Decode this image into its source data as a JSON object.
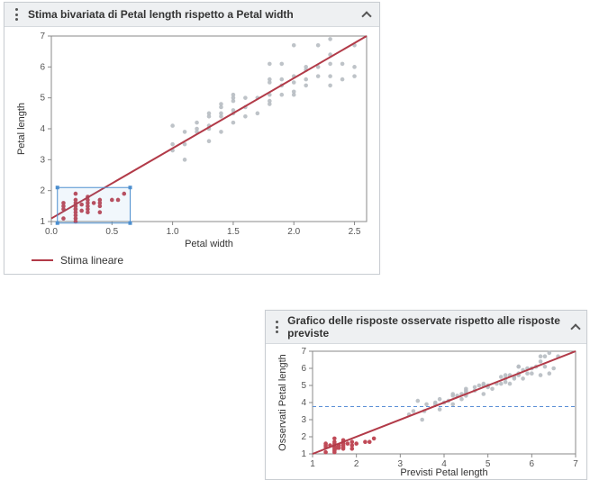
{
  "panel_top": {
    "title": "Stima bivariata di Petal length rispetto a Petal width",
    "legend_label": "Stima lineare"
  },
  "panel_bottom": {
    "title": "Grafico delle risposte osservate rispetto alle risposte previste"
  },
  "colors": {
    "fit": "#b23a48",
    "point_gray": "#b7bcc2",
    "point_red": "#c04a57",
    "dashed": "#5a8fd6"
  },
  "chart_data": [
    {
      "id": "bivariate",
      "type": "scatter",
      "title": "Stima bivariata di Petal length rispetto a Petal width",
      "xlabel": "Petal width",
      "ylabel": "Petal length",
      "xlim": [
        0.0,
        2.6
      ],
      "ylim": [
        1,
        7
      ],
      "xticks": [
        0.0,
        0.5,
        1.0,
        1.5,
        2.0,
        2.5
      ],
      "yticks": [
        1,
        2,
        3,
        4,
        5,
        6,
        7
      ],
      "fit_line": {
        "x1": 0.0,
        "y1": 1.1,
        "x2": 2.6,
        "y2": 7.0
      },
      "selection_rect": {
        "x1": 0.05,
        "y1": 0.95,
        "x2": 0.65,
        "y2": 2.1
      },
      "legend": "Stima lineare",
      "series": [
        {
          "name": "selected",
          "color": "red",
          "points": [
            [
              0.1,
              1.4
            ],
            [
              0.2,
              1.4
            ],
            [
              0.2,
              1.3
            ],
            [
              0.2,
              1.5
            ],
            [
              0.2,
              1.2
            ],
            [
              0.2,
              1.6
            ],
            [
              0.2,
              1.0
            ],
            [
              0.1,
              1.5
            ],
            [
              0.2,
              1.7
            ],
            [
              0.1,
              1.1
            ],
            [
              0.3,
              1.4
            ],
            [
              0.3,
              1.6
            ],
            [
              0.3,
              1.3
            ],
            [
              0.4,
              1.5
            ],
            [
              0.4,
              1.7
            ],
            [
              0.2,
              1.9
            ],
            [
              0.4,
              1.3
            ],
            [
              0.1,
              1.6
            ],
            [
              0.3,
              1.5
            ],
            [
              0.2,
              1.4
            ],
            [
              0.25,
              1.55
            ],
            [
              0.3,
              1.7
            ],
            [
              0.2,
              1.1
            ],
            [
              0.35,
              1.6
            ],
            [
              0.3,
              1.8
            ],
            [
              0.25,
              1.35
            ],
            [
              0.4,
              1.6
            ],
            [
              0.5,
              1.7
            ],
            [
              0.55,
              1.7
            ],
            [
              0.6,
              1.9
            ]
          ]
        },
        {
          "name": "unselected",
          "color": "gray",
          "points": [
            [
              1.0,
              3.3
            ],
            [
              1.0,
              3.5
            ],
            [
              1.1,
              3.0
            ],
            [
              1.1,
              3.9
            ],
            [
              1.2,
              3.9
            ],
            [
              1.2,
              4.0
            ],
            [
              1.3,
              4.0
            ],
            [
              1.3,
              4.1
            ],
            [
              1.3,
              4.4
            ],
            [
              1.3,
              3.6
            ],
            [
              1.3,
              4.5
            ],
            [
              1.4,
              4.5
            ],
            [
              1.4,
              4.7
            ],
            [
              1.4,
              3.9
            ],
            [
              1.4,
              4.8
            ],
            [
              1.4,
              4.4
            ],
            [
              1.5,
              4.5
            ],
            [
              1.5,
              4.9
            ],
            [
              1.5,
              4.6
            ],
            [
              1.5,
              5.1
            ],
            [
              1.5,
              4.2
            ],
            [
              1.5,
              5.0
            ],
            [
              1.6,
              4.7
            ],
            [
              1.6,
              5.0
            ],
            [
              1.6,
              4.4
            ],
            [
              1.7,
              4.5
            ],
            [
              1.7,
              5.0
            ],
            [
              1.8,
              4.8
            ],
            [
              1.8,
              5.1
            ],
            [
              1.8,
              5.5
            ],
            [
              1.8,
              5.6
            ],
            [
              1.8,
              6.1
            ],
            [
              1.8,
              4.9
            ],
            [
              1.9,
              5.1
            ],
            [
              1.9,
              5.4
            ],
            [
              1.9,
              5.6
            ],
            [
              1.9,
              6.1
            ],
            [
              2.0,
              5.1
            ],
            [
              2.0,
              5.5
            ],
            [
              2.0,
              5.7
            ],
            [
              2.0,
              6.7
            ],
            [
              2.0,
              5.2
            ],
            [
              2.1,
              5.6
            ],
            [
              2.1,
              5.9
            ],
            [
              2.1,
              5.4
            ],
            [
              2.1,
              6.0
            ],
            [
              2.2,
              5.7
            ],
            [
              2.2,
              6.0
            ],
            [
              2.2,
              6.7
            ],
            [
              2.3,
              5.7
            ],
            [
              2.3,
              6.1
            ],
            [
              2.3,
              6.9
            ],
            [
              2.3,
              5.4
            ],
            [
              2.3,
              6.4
            ],
            [
              2.4,
              5.6
            ],
            [
              2.4,
              6.1
            ],
            [
              2.5,
              5.7
            ],
            [
              2.5,
              6.0
            ],
            [
              2.5,
              6.7
            ],
            [
              1.0,
              4.1
            ],
            [
              1.1,
              3.5
            ],
            [
              1.2,
              4.2
            ]
          ]
        }
      ]
    },
    {
      "id": "obs_vs_pred",
      "type": "scatter",
      "title": "Grafico delle risposte osservate rispetto alle risposte previste",
      "xlabel": "Previsti Petal length",
      "ylabel": "Osservati Petal length",
      "xlim": [
        1,
        7
      ],
      "ylim": [
        1,
        7
      ],
      "xticks": [
        1,
        2,
        3,
        4,
        5,
        6,
        7
      ],
      "yticks": [
        1,
        2,
        3,
        4,
        5,
        6,
        7
      ],
      "ref_line_y": 3.76,
      "fit_line": {
        "x1": 1.0,
        "y1": 1.0,
        "x2": 7.0,
        "y2": 7.0
      },
      "series": [
        {
          "name": "selected",
          "color": "red",
          "points": [
            [
              1.3,
              1.4
            ],
            [
              1.5,
              1.4
            ],
            [
              1.5,
              1.3
            ],
            [
              1.5,
              1.5
            ],
            [
              1.3,
              1.5
            ],
            [
              1.5,
              1.7
            ],
            [
              1.3,
              1.1
            ],
            [
              1.3,
              1.6
            ],
            [
              1.7,
              1.4
            ],
            [
              1.7,
              1.6
            ],
            [
              1.7,
              1.3
            ],
            [
              1.9,
              1.5
            ],
            [
              1.9,
              1.7
            ],
            [
              1.5,
              1.9
            ],
            [
              1.5,
              1.2
            ],
            [
              1.9,
              1.3
            ],
            [
              1.7,
              1.5
            ],
            [
              1.7,
              1.7
            ],
            [
              1.5,
              1.1
            ],
            [
              1.8,
              1.6
            ],
            [
              1.7,
              1.8
            ],
            [
              1.6,
              1.35
            ],
            [
              2.0,
              1.6
            ],
            [
              2.2,
              1.7
            ],
            [
              2.3,
              1.7
            ],
            [
              2.4,
              1.9
            ],
            [
              1.5,
              1.6
            ],
            [
              1.4,
              1.5
            ],
            [
              1.6,
              1.5
            ],
            [
              1.55,
              1.35
            ]
          ]
        },
        {
          "name": "unselected",
          "color": "gray",
          "points": [
            [
              3.2,
              3.3
            ],
            [
              3.3,
              3.5
            ],
            [
              3.5,
              3.0
            ],
            [
              3.6,
              3.9
            ],
            [
              3.8,
              3.9
            ],
            [
              3.8,
              4.0
            ],
            [
              4.0,
              4.0
            ],
            [
              4.1,
              4.1
            ],
            [
              4.2,
              4.4
            ],
            [
              3.9,
              3.6
            ],
            [
              4.2,
              4.5
            ],
            [
              4.4,
              4.5
            ],
            [
              4.5,
              4.7
            ],
            [
              4.2,
              3.9
            ],
            [
              4.5,
              4.8
            ],
            [
              4.3,
              4.4
            ],
            [
              4.5,
              4.5
            ],
            [
              4.7,
              4.9
            ],
            [
              4.5,
              4.6
            ],
            [
              4.9,
              5.1
            ],
            [
              4.4,
              4.2
            ],
            [
              4.8,
              5.0
            ],
            [
              4.7,
              4.7
            ],
            [
              4.9,
              5.0
            ],
            [
              4.5,
              4.4
            ],
            [
              4.9,
              4.5
            ],
            [
              5.0,
              5.0
            ],
            [
              5.1,
              4.8
            ],
            [
              5.2,
              5.1
            ],
            [
              5.3,
              5.5
            ],
            [
              5.4,
              5.6
            ],
            [
              5.7,
              6.1
            ],
            [
              5.0,
              4.9
            ],
            [
              5.3,
              5.1
            ],
            [
              5.4,
              5.4
            ],
            [
              5.5,
              5.6
            ],
            [
              5.7,
              6.1
            ],
            [
              5.5,
              5.1
            ],
            [
              5.6,
              5.5
            ],
            [
              5.7,
              5.7
            ],
            [
              6.2,
              6.7
            ],
            [
              5.4,
              5.2
            ],
            [
              5.7,
              5.6
            ],
            [
              5.8,
              5.9
            ],
            [
              5.6,
              5.4
            ],
            [
              5.9,
              6.0
            ],
            [
              5.9,
              5.7
            ],
            [
              6.0,
              6.0
            ],
            [
              6.3,
              6.7
            ],
            [
              6.0,
              5.7
            ],
            [
              6.1,
              6.1
            ],
            [
              6.4,
              6.9
            ],
            [
              5.8,
              5.4
            ],
            [
              6.2,
              6.4
            ],
            [
              6.2,
              5.6
            ],
            [
              6.3,
              6.1
            ],
            [
              6.4,
              5.7
            ],
            [
              6.5,
              6.0
            ],
            [
              6.6,
              6.7
            ],
            [
              3.4,
              4.1
            ],
            [
              3.55,
              3.5
            ],
            [
              3.9,
              4.2
            ]
          ]
        }
      ]
    }
  ]
}
